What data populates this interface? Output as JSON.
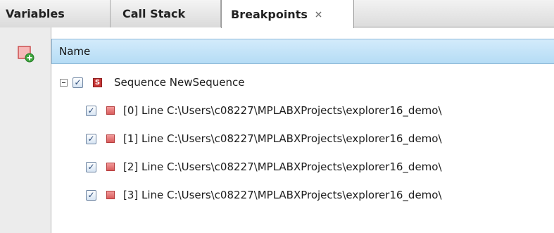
{
  "tabs": [
    {
      "label": "Variables"
    },
    {
      "label": "Call Stack"
    },
    {
      "label": "Breakpoints",
      "close_glyph": "⌘"
    }
  ],
  "toolbar": {
    "new_breakpoint_icon": "new-breakpoint-icon"
  },
  "table": {
    "column_header": "Name",
    "sequence": {
      "label": "Sequence NewSequence",
      "icon_letter": "S",
      "checked": true
    },
    "breakpoints": [
      {
        "label": "[0] Line C:\\Users\\c08227\\MPLABXProjects\\explorer16_demo\\",
        "checked": true
      },
      {
        "label": "[1] Line C:\\Users\\c08227\\MPLABXProjects\\explorer16_demo\\",
        "checked": true
      },
      {
        "label": "[2] Line C:\\Users\\c08227\\MPLABXProjects\\explorer16_demo\\",
        "checked": true
      },
      {
        "label": "[3] Line C:\\Users\\c08227\\MPLABXProjects\\explorer16_demo\\",
        "checked": true
      }
    ]
  },
  "colors": {
    "header_blue": "#c4e3f8",
    "breakpoint_red": "#d95c5c",
    "toolbar_bg": "#ececec"
  }
}
